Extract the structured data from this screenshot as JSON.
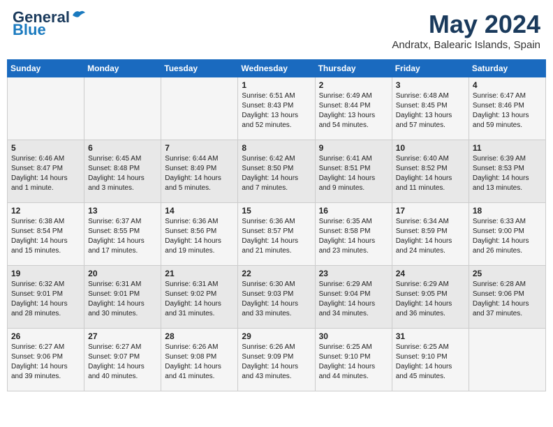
{
  "header": {
    "logo_line1": "General",
    "logo_line2": "Blue",
    "month_year": "May 2024",
    "location": "Andratx, Balearic Islands, Spain"
  },
  "days_of_week": [
    "Sunday",
    "Monday",
    "Tuesday",
    "Wednesday",
    "Thursday",
    "Friday",
    "Saturday"
  ],
  "weeks": [
    [
      {
        "day": "",
        "content": ""
      },
      {
        "day": "",
        "content": ""
      },
      {
        "day": "",
        "content": ""
      },
      {
        "day": "1",
        "content": "Sunrise: 6:51 AM\nSunset: 8:43 PM\nDaylight: 13 hours\nand 52 minutes."
      },
      {
        "day": "2",
        "content": "Sunrise: 6:49 AM\nSunset: 8:44 PM\nDaylight: 13 hours\nand 54 minutes."
      },
      {
        "day": "3",
        "content": "Sunrise: 6:48 AM\nSunset: 8:45 PM\nDaylight: 13 hours\nand 57 minutes."
      },
      {
        "day": "4",
        "content": "Sunrise: 6:47 AM\nSunset: 8:46 PM\nDaylight: 13 hours\nand 59 minutes."
      }
    ],
    [
      {
        "day": "5",
        "content": "Sunrise: 6:46 AM\nSunset: 8:47 PM\nDaylight: 14 hours\nand 1 minute."
      },
      {
        "day": "6",
        "content": "Sunrise: 6:45 AM\nSunset: 8:48 PM\nDaylight: 14 hours\nand 3 minutes."
      },
      {
        "day": "7",
        "content": "Sunrise: 6:44 AM\nSunset: 8:49 PM\nDaylight: 14 hours\nand 5 minutes."
      },
      {
        "day": "8",
        "content": "Sunrise: 6:42 AM\nSunset: 8:50 PM\nDaylight: 14 hours\nand 7 minutes."
      },
      {
        "day": "9",
        "content": "Sunrise: 6:41 AM\nSunset: 8:51 PM\nDaylight: 14 hours\nand 9 minutes."
      },
      {
        "day": "10",
        "content": "Sunrise: 6:40 AM\nSunset: 8:52 PM\nDaylight: 14 hours\nand 11 minutes."
      },
      {
        "day": "11",
        "content": "Sunrise: 6:39 AM\nSunset: 8:53 PM\nDaylight: 14 hours\nand 13 minutes."
      }
    ],
    [
      {
        "day": "12",
        "content": "Sunrise: 6:38 AM\nSunset: 8:54 PM\nDaylight: 14 hours\nand 15 minutes."
      },
      {
        "day": "13",
        "content": "Sunrise: 6:37 AM\nSunset: 8:55 PM\nDaylight: 14 hours\nand 17 minutes."
      },
      {
        "day": "14",
        "content": "Sunrise: 6:36 AM\nSunset: 8:56 PM\nDaylight: 14 hours\nand 19 minutes."
      },
      {
        "day": "15",
        "content": "Sunrise: 6:36 AM\nSunset: 8:57 PM\nDaylight: 14 hours\nand 21 minutes."
      },
      {
        "day": "16",
        "content": "Sunrise: 6:35 AM\nSunset: 8:58 PM\nDaylight: 14 hours\nand 23 minutes."
      },
      {
        "day": "17",
        "content": "Sunrise: 6:34 AM\nSunset: 8:59 PM\nDaylight: 14 hours\nand 24 minutes."
      },
      {
        "day": "18",
        "content": "Sunrise: 6:33 AM\nSunset: 9:00 PM\nDaylight: 14 hours\nand 26 minutes."
      }
    ],
    [
      {
        "day": "19",
        "content": "Sunrise: 6:32 AM\nSunset: 9:01 PM\nDaylight: 14 hours\nand 28 minutes."
      },
      {
        "day": "20",
        "content": "Sunrise: 6:31 AM\nSunset: 9:01 PM\nDaylight: 14 hours\nand 30 minutes."
      },
      {
        "day": "21",
        "content": "Sunrise: 6:31 AM\nSunset: 9:02 PM\nDaylight: 14 hours\nand 31 minutes."
      },
      {
        "day": "22",
        "content": "Sunrise: 6:30 AM\nSunset: 9:03 PM\nDaylight: 14 hours\nand 33 minutes."
      },
      {
        "day": "23",
        "content": "Sunrise: 6:29 AM\nSunset: 9:04 PM\nDaylight: 14 hours\nand 34 minutes."
      },
      {
        "day": "24",
        "content": "Sunrise: 6:29 AM\nSunset: 9:05 PM\nDaylight: 14 hours\nand 36 minutes."
      },
      {
        "day": "25",
        "content": "Sunrise: 6:28 AM\nSunset: 9:06 PM\nDaylight: 14 hours\nand 37 minutes."
      }
    ],
    [
      {
        "day": "26",
        "content": "Sunrise: 6:27 AM\nSunset: 9:06 PM\nDaylight: 14 hours\nand 39 minutes."
      },
      {
        "day": "27",
        "content": "Sunrise: 6:27 AM\nSunset: 9:07 PM\nDaylight: 14 hours\nand 40 minutes."
      },
      {
        "day": "28",
        "content": "Sunrise: 6:26 AM\nSunset: 9:08 PM\nDaylight: 14 hours\nand 41 minutes."
      },
      {
        "day": "29",
        "content": "Sunrise: 6:26 AM\nSunset: 9:09 PM\nDaylight: 14 hours\nand 43 minutes."
      },
      {
        "day": "30",
        "content": "Sunrise: 6:25 AM\nSunset: 9:10 PM\nDaylight: 14 hours\nand 44 minutes."
      },
      {
        "day": "31",
        "content": "Sunrise: 6:25 AM\nSunset: 9:10 PM\nDaylight: 14 hours\nand 45 minutes."
      },
      {
        "day": "",
        "content": ""
      }
    ]
  ]
}
